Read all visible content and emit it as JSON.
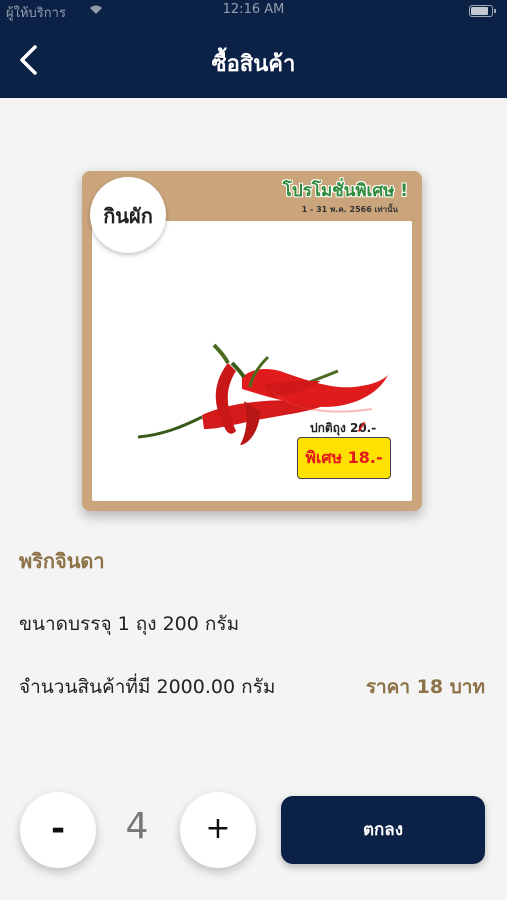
{
  "status_bar": {
    "carrier": "ผู้ให้บริการ",
    "time": "12:16 AM",
    "battery_level": 0.9,
    "wifi_icon": "wifi-icon"
  },
  "nav": {
    "title": "ซื้อสินค้า",
    "back_icon": "chevron-left-icon"
  },
  "product_image": {
    "brand": "กินผัก",
    "promo_title": "โปรโมชั่นพิเศษ !",
    "promo_date": "1 - 31 พ.ค. 2566 เท่านั้น",
    "normal_price": "ปกติถุง 20.-",
    "special_price": "พิเศษ 18.-"
  },
  "product": {
    "name": "พริกจินดา",
    "pack_size": "ขนาดบรรจุ 1 ถุง 200 กรัม",
    "stock": "จำนวนสินค้าที่มี 2000.00 กรัม",
    "price": "ราคา 18 บาท"
  },
  "quantity": {
    "minus_label": "-",
    "value": "4",
    "plus_label": "+"
  },
  "confirm_label": "ตกลง",
  "colors": {
    "nav_background": "#0c2146",
    "accent_gold": "#8c7246",
    "card_kraft": "#caa57b",
    "badge_yellow": "#ffe100"
  }
}
